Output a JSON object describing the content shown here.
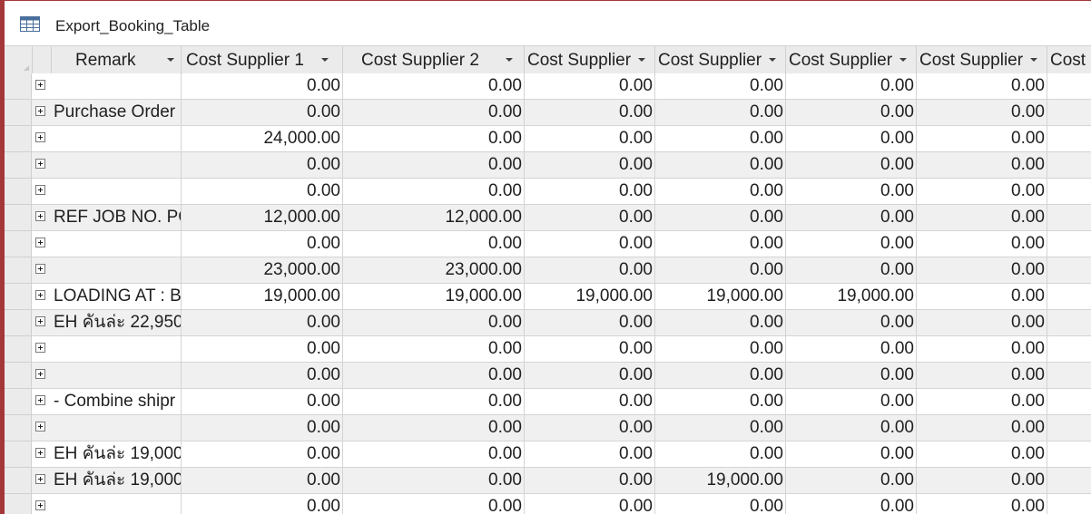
{
  "window": {
    "tab_title": "Export_Booking_Table",
    "tab_icon": "table-icon"
  },
  "columns": [
    {
      "key": "remark",
      "label": "Remark"
    },
    {
      "key": "cs1",
      "label": "Cost Supplier 1"
    },
    {
      "key": "cs2",
      "label": "Cost Supplier 2"
    },
    {
      "key": "cs3",
      "label": "Cost Supplier"
    },
    {
      "key": "cs4",
      "label": "Cost Supplier"
    },
    {
      "key": "cs5",
      "label": "Cost Supplier"
    },
    {
      "key": "cs6",
      "label": "Cost Supplier"
    },
    {
      "key": "cs7",
      "label": "Cost"
    }
  ],
  "rows": [
    {
      "remark": "",
      "values": [
        "0.00",
        "0.00",
        "0.00",
        "0.00",
        "0.00",
        "0.00",
        ""
      ]
    },
    {
      "remark": "Purchase Order",
      "values": [
        "0.00",
        "0.00",
        "0.00",
        "0.00",
        "0.00",
        "0.00",
        ""
      ]
    },
    {
      "remark": "",
      "values": [
        "24,000.00",
        "0.00",
        "0.00",
        "0.00",
        "0.00",
        "0.00",
        ""
      ]
    },
    {
      "remark": "",
      "values": [
        "0.00",
        "0.00",
        "0.00",
        "0.00",
        "0.00",
        "0.00",
        ""
      ]
    },
    {
      "remark": "",
      "values": [
        "0.00",
        "0.00",
        "0.00",
        "0.00",
        "0.00",
        "0.00",
        ""
      ]
    },
    {
      "remark": "REF JOB NO. PC",
      "values": [
        "12,000.00",
        "12,000.00",
        "0.00",
        "0.00",
        "0.00",
        "0.00",
        ""
      ]
    },
    {
      "remark": "",
      "values": [
        "0.00",
        "0.00",
        "0.00",
        "0.00",
        "0.00",
        "0.00",
        ""
      ]
    },
    {
      "remark": "",
      "values": [
        "23,000.00",
        "23,000.00",
        "0.00",
        "0.00",
        "0.00",
        "0.00",
        ""
      ]
    },
    {
      "remark": "LOADING AT : B",
      "values": [
        "19,000.00",
        "19,000.00",
        "19,000.00",
        "19,000.00",
        "19,000.00",
        "0.00",
        ""
      ]
    },
    {
      "remark": "EH คันล่ะ 22,950",
      "values": [
        "0.00",
        "0.00",
        "0.00",
        "0.00",
        "0.00",
        "0.00",
        ""
      ]
    },
    {
      "remark": "",
      "values": [
        "0.00",
        "0.00",
        "0.00",
        "0.00",
        "0.00",
        "0.00",
        ""
      ]
    },
    {
      "remark": "",
      "values": [
        "0.00",
        "0.00",
        "0.00",
        "0.00",
        "0.00",
        "0.00",
        ""
      ]
    },
    {
      "remark": "- Combine shipr",
      "values": [
        "0.00",
        "0.00",
        "0.00",
        "0.00",
        "0.00",
        "0.00",
        ""
      ]
    },
    {
      "remark": "",
      "values": [
        "0.00",
        "0.00",
        "0.00",
        "0.00",
        "0.00",
        "0.00",
        ""
      ]
    },
    {
      "remark": "EH คันล่ะ 19,000",
      "values": [
        "0.00",
        "0.00",
        "0.00",
        "0.00",
        "0.00",
        "0.00",
        ""
      ]
    },
    {
      "remark": "EH คันล่ะ 19,000",
      "values": [
        "0.00",
        "0.00",
        "0.00",
        "19,000.00",
        "0.00",
        "0.00",
        ""
      ]
    },
    {
      "remark": "",
      "values": [
        "0.00",
        "0.00",
        "0.00",
        "0.00",
        "0.00",
        "0.00",
        ""
      ]
    }
  ]
}
